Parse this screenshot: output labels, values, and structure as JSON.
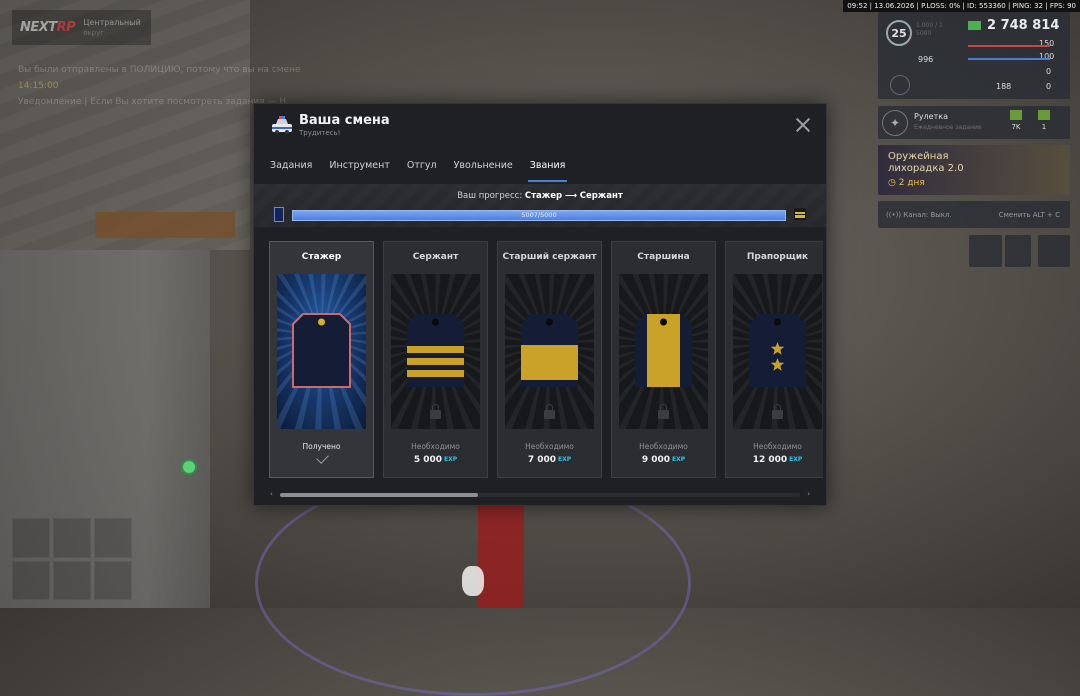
{
  "hud": {
    "status_text": "09:52 | 13.06.2026 | P.LOSS: 0% | ID: 553360 | PING: 32 | FPS: 90",
    "logo_main": "NEXT",
    "logo_accent": "RP",
    "server_name": "Центральный",
    "server_sub": "округ",
    "chat_line_1": "Вы были отправлены в ПОЛИЦИЮ, потому что вы на смене",
    "chat_line_2": "14:15:00",
    "chat_line_3": "Уведомление | Если Вы хотите посмотреть задания — Н",
    "level": "25",
    "level_sub_1": "1.000 / 1",
    "level_sub_2": "5000",
    "money": "2 748 814",
    "health": "150",
    "armor": "100",
    "stat_a": "996",
    "stat_b": "0",
    "stat_c": "188",
    "stat_d": "0",
    "roulette_title": "Рулетка",
    "roulette_sub": "Ежедневное задание",
    "roulette_val_1": "7K",
    "roulette_val_2": "1",
    "event_title_1": "Оружейная",
    "event_title_2": "лихорадка 2.0",
    "event_days": "2 дня",
    "voice_left": "Канал: Выкл.",
    "voice_right": "Сменить  ALT + C"
  },
  "modal": {
    "title": "Ваша смена",
    "subtitle": "Трудитесь!",
    "tabs": [
      {
        "label": "Задания"
      },
      {
        "label": "Инструмент"
      },
      {
        "label": "Отгул"
      },
      {
        "label": "Увольнение"
      },
      {
        "label": "Звания"
      }
    ],
    "active_tab": 4,
    "progress_prefix": "Ваш прогресс:",
    "progress_from": "Стажер",
    "progress_arrow": "⟶",
    "progress_to": "Сержант",
    "progress_text": "5007/5000",
    "progress_value": 1.0,
    "ranks": [
      {
        "name": "Стажер",
        "status": "Получено",
        "requirement": "",
        "exp": "",
        "current": true,
        "insignia": "plain"
      },
      {
        "name": "Сержант",
        "status": "Необходимо",
        "requirement": "5 000",
        "exp": "EXP",
        "current": false,
        "insignia": "three-stripes"
      },
      {
        "name": "Старший сержант",
        "status": "Необходимо",
        "requirement": "7 000",
        "exp": "EXP",
        "current": false,
        "insignia": "wide-band"
      },
      {
        "name": "Старшина",
        "status": "Необходимо",
        "requirement": "9 000",
        "exp": "EXP",
        "current": false,
        "insignia": "vertical-band"
      },
      {
        "name": "Прапорщик",
        "status": "Необходимо",
        "requirement": "12 000",
        "exp": "EXP",
        "current": false,
        "insignia": "two-stars"
      }
    ],
    "scroll_position": 0.0,
    "scroll_visible_fraction": 0.38
  },
  "colors": {
    "accent": "#4a7fd6",
    "exp": "#2cc3e8",
    "gold": "#c9a227",
    "insignia_navy": "#151c36",
    "current_border": "#d06a6a"
  }
}
